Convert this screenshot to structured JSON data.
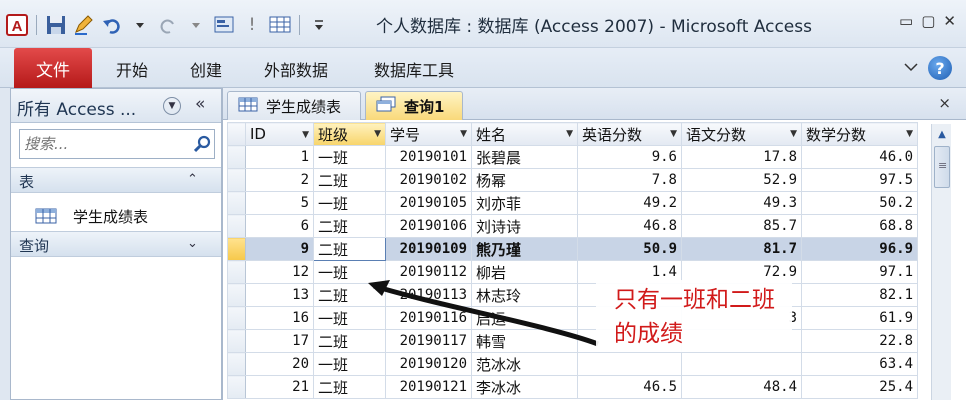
{
  "window": {
    "title": "个人数据库 : 数据库 (Access 2007)  -  Microsoft Access",
    "controls": [
      "▭",
      "▢",
      "✕"
    ]
  },
  "ribbon": {
    "file_tab": "文件",
    "tabs": [
      "开始",
      "创建",
      "外部数据",
      "数据库工具"
    ],
    "help": "?"
  },
  "nav": {
    "title": "所有 Access ...",
    "collapse": "«",
    "search_placeholder": "搜索...",
    "groups": [
      {
        "label": "表",
        "chevron": "⌃"
      },
      {
        "label": "查询",
        "chevron": "⌄"
      }
    ],
    "items": [
      {
        "label": "学生成绩表",
        "group": "表"
      }
    ]
  },
  "doc": {
    "tabs": [
      {
        "label": "学生成绩表",
        "icon": "table-icon",
        "active": false
      },
      {
        "label": "查询1",
        "icon": "query-icon",
        "active": true
      }
    ],
    "close": "×"
  },
  "grid": {
    "columns": [
      "ID",
      "班级",
      "学号",
      "姓名",
      "英语分数",
      "语文分数",
      "数学分数"
    ],
    "sorted_column": "班级",
    "selected_row": 4,
    "rows": [
      [
        "1",
        "一班",
        "20190101",
        "张碧晨",
        "9.6",
        "17.8",
        "46.0"
      ],
      [
        "2",
        "二班",
        "20190102",
        "杨幂",
        "7.8",
        "52.9",
        "97.5"
      ],
      [
        "5",
        "一班",
        "20190105",
        "刘亦菲",
        "49.2",
        "49.3",
        "50.2"
      ],
      [
        "6",
        "二班",
        "20190106",
        "刘诗诗",
        "46.8",
        "85.7",
        "68.8"
      ],
      [
        "9",
        "二班",
        "20190109",
        "熊乃瑾",
        "50.9",
        "81.7",
        "96.9"
      ],
      [
        "12",
        "一班",
        "20190112",
        "柳岩",
        "1.4",
        "72.9",
        "97.1"
      ],
      [
        "13",
        "二班",
        "20190113",
        "林志玲",
        "",
        "",
        "82.1"
      ],
      [
        "16",
        "一班",
        "20190116",
        "启运",
        "",
        "3",
        "61.9"
      ],
      [
        "17",
        "二班",
        "20190117",
        "韩雪",
        "",
        "",
        "22.8"
      ],
      [
        "20",
        "一班",
        "20190120",
        "范冰冰",
        "",
        "",
        "63.4"
      ],
      [
        "21",
        "二班",
        "20190121",
        "李冰冰",
        "46.5",
        "48.4",
        "25.4"
      ]
    ]
  },
  "annotation": {
    "text": "只有一班和二班的成绩",
    "color": "#d11a1a"
  }
}
